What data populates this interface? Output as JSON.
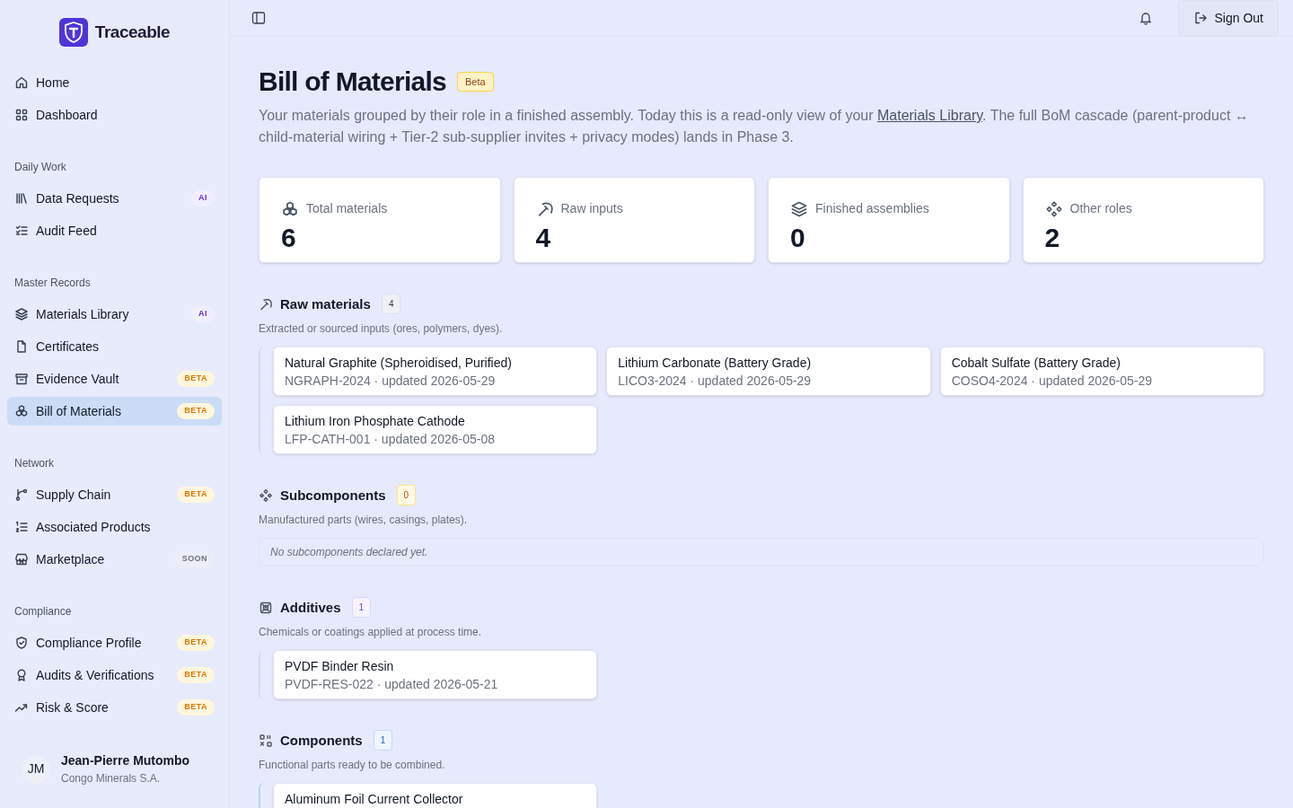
{
  "brand": {
    "name": "Traceable"
  },
  "sidebar": {
    "groups": [
      {
        "items": [
          {
            "label": "Home",
            "selected": false
          },
          {
            "label": "Dashboard",
            "selected": false
          }
        ]
      },
      {
        "title": "Daily Work",
        "items": [
          {
            "label": "Data Requests",
            "selected": false,
            "badge": {
              "text": "AI",
              "kind": "ai"
            }
          },
          {
            "label": "Audit Feed",
            "selected": false
          }
        ]
      },
      {
        "title": "Master Records",
        "items": [
          {
            "label": "Materials Library",
            "selected": false,
            "badge": {
              "text": "AI",
              "kind": "ai"
            }
          },
          {
            "label": "Certificates",
            "selected": false
          },
          {
            "label": "Evidence Vault",
            "selected": false,
            "badge": {
              "text": "BETA",
              "kind": "beta"
            }
          },
          {
            "label": "Bill of Materials",
            "selected": true,
            "badge": {
              "text": "BETA",
              "kind": "beta"
            }
          }
        ]
      },
      {
        "title": "Network",
        "items": [
          {
            "label": "Supply Chain",
            "selected": false,
            "badge": {
              "text": "BETA",
              "kind": "beta"
            }
          },
          {
            "label": "Associated Products",
            "selected": false
          },
          {
            "label": "Marketplace",
            "selected": false,
            "badge": {
              "text": "SOON",
              "kind": "soon"
            }
          }
        ]
      },
      {
        "title": "Compliance",
        "items": [
          {
            "label": "Compliance Profile",
            "selected": false,
            "badge": {
              "text": "BETA",
              "kind": "beta"
            }
          },
          {
            "label": "Audits & Verifications",
            "selected": false,
            "badge": {
              "text": "BETA",
              "kind": "beta"
            }
          },
          {
            "label": "Risk & Score",
            "selected": false,
            "badge": {
              "text": "BETA",
              "kind": "beta"
            }
          }
        ]
      }
    ],
    "user": {
      "initials": "JM",
      "name": "Jean-Pierre Mutombo",
      "org": "Congo Minerals S.A."
    }
  },
  "topbar": {
    "sign_out": "Sign Out"
  },
  "page": {
    "title": "Bill of Materials",
    "badge": "Beta",
    "intro_before": "Your materials grouped by their role in a finished assembly. Today this is a read-only view of your ",
    "intro_link": "Materials Library",
    "intro_after": ". The full BoM cascade (parent-product ↔ child-material wiring + Tier-2 sub-supplier invites + privacy modes) lands in Phase 3."
  },
  "stats": [
    {
      "label": "Total materials",
      "value": "6"
    },
    {
      "label": "Raw inputs",
      "value": "4"
    },
    {
      "label": "Finished assemblies",
      "value": "0"
    },
    {
      "label": "Other roles",
      "value": "2"
    }
  ],
  "sections": [
    {
      "title": "Raw materials",
      "count": "4",
      "kind": "neutral",
      "description": "Extracted or sourced inputs (ores, polymers, dyes).",
      "materials": [
        {
          "name": "Natural Graphite (Spheroidised, Purified)",
          "meta": "NGRAPH-2024 · updated 2026-05-29"
        },
        {
          "name": "Lithium Carbonate (Battery Grade)",
          "meta": "LICO3-2024 · updated 2026-05-29"
        },
        {
          "name": "Cobalt Sulfate (Battery Grade)",
          "meta": "COSO4-2024 · updated 2026-05-29"
        },
        {
          "name": "Lithium Iron Phosphate Cathode",
          "meta": "LFP-CATH-001 · updated 2026-05-08"
        }
      ]
    },
    {
      "title": "Subcomponents",
      "count": "0",
      "kind": "amber",
      "description": "Manufactured parts (wires, casings, plates).",
      "empty": "No subcomponents declared yet."
    },
    {
      "title": "Additives",
      "count": "1",
      "kind": "violet",
      "description": "Chemicals or coatings applied at process time.",
      "materials": [
        {
          "name": "PVDF Binder Resin",
          "meta": "PVDF-RES-022 · updated 2026-05-21"
        }
      ]
    },
    {
      "title": "Components",
      "count": "1",
      "kind": "blue",
      "description": "Functional parts ready to be combined.",
      "materials": [
        {
          "name": "Aluminum Foil Current Collector"
        }
      ]
    }
  ]
}
